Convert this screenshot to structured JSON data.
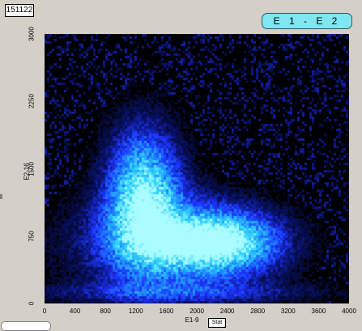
{
  "counter": {
    "value": "151122"
  },
  "title_pill": {
    "label": "E 1 - E 2"
  },
  "stat_button": {
    "label": "Stat"
  },
  "chart_data": {
    "type": "heatmap",
    "title": "E 1 - E 2",
    "xlabel": "E1-9",
    "ylabel": "E2-16",
    "xlim": [
      0,
      4000
    ],
    "ylim": [
      0,
      3000
    ],
    "x_ticks": [
      "0",
      "400",
      "800",
      "1200",
      "1600",
      "2000",
      "2400",
      "2800",
      "3200",
      "3600",
      "4000"
    ],
    "y_ticks": [
      "0",
      "750",
      "1500",
      "2250",
      "3000"
    ],
    "colormap": [
      "#000000",
      "#08105e",
      "#1c33ff",
      "#1f8fff",
      "#34d6ff",
      "#aafcff"
    ],
    "clusters": [
      {
        "x": 1300,
        "y": 1200,
        "sx": 340,
        "sy": 520,
        "weight": 1.0
      },
      {
        "x": 2300,
        "y": 680,
        "sx": 520,
        "sy": 230,
        "weight": 0.95
      },
      {
        "x": 1650,
        "y": 650,
        "sx": 900,
        "sy": 380,
        "weight": 0.55
      },
      {
        "x": 1800,
        "y": 120,
        "sx": 1400,
        "sy": 80,
        "weight": 0.3
      }
    ],
    "grid": false
  }
}
